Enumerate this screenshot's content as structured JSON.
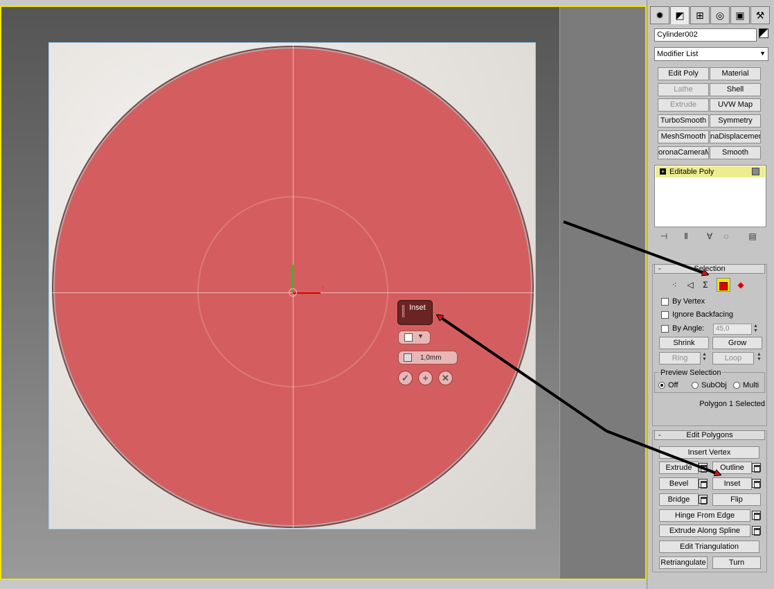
{
  "panel": {
    "tabs": [
      {
        "icon": "create-icon",
        "glyph": "✹"
      },
      {
        "icon": "modify-icon",
        "glyph": "◩"
      },
      {
        "icon": "hierarchy-icon",
        "glyph": "⊞"
      },
      {
        "icon": "motion-icon",
        "glyph": "◎"
      },
      {
        "icon": "display-icon",
        "glyph": "▣"
      },
      {
        "icon": "utilities-icon",
        "glyph": "⚒"
      }
    ],
    "object_name": "Cylinder002",
    "modifier_list": "Modifier List",
    "modifier_buttons": [
      {
        "label": "Edit Poly",
        "disabled": false
      },
      {
        "label": "Material",
        "disabled": false
      },
      {
        "label": "Lathe",
        "disabled": true
      },
      {
        "label": "Shell",
        "disabled": false
      },
      {
        "label": "Extrude",
        "disabled": true
      },
      {
        "label": "UVW Map",
        "disabled": false
      },
      {
        "label": "TurboSmooth",
        "disabled": false
      },
      {
        "label": "Symmetry",
        "disabled": false
      },
      {
        "label": "MeshSmooth",
        "disabled": false
      },
      {
        "label": "naDisplacemen",
        "disabled": false
      },
      {
        "label": "oronaCameraMo",
        "disabled": false
      },
      {
        "label": "Smooth",
        "disabled": false
      }
    ],
    "stack_item": "Editable Poly",
    "selection": {
      "header": "Selection",
      "by_vertex": "By Vertex",
      "ignore_backfacing": "Ignore Backfacing",
      "by_angle": "By Angle:",
      "angle_value": "45,0",
      "shrink": "Shrink",
      "grow": "Grow",
      "ring": "Ring",
      "loop": "Loop",
      "preview_title": "Preview Selection",
      "preview_off": "Off",
      "preview_subobj": "SubObj",
      "preview_multi": "Multi",
      "status": "Polygon 1 Selected"
    },
    "edit_polygons": {
      "header": "Edit Polygons",
      "insert_vertex": "Insert Vertex",
      "extrude": "Extrude",
      "outline": "Outline",
      "bevel": "Bevel",
      "inset": "Inset",
      "bridge": "Bridge",
      "flip": "Flip",
      "hinge": "Hinge From Edge",
      "extrude_spline": "Extrude Along Spline",
      "edit_tri": "Edit Triangulation",
      "retriangulate": "Retriangulate",
      "turn": "Turn"
    }
  },
  "viewport": {
    "caddy": {
      "title": "Inset",
      "amount": "1,0mm"
    },
    "gizmo": {
      "x": "x",
      "y": "y"
    }
  },
  "colors": {
    "selection_red": "#d45e5f",
    "viewport_border": "#f2e800",
    "stack_highlight": "#eded8f"
  }
}
